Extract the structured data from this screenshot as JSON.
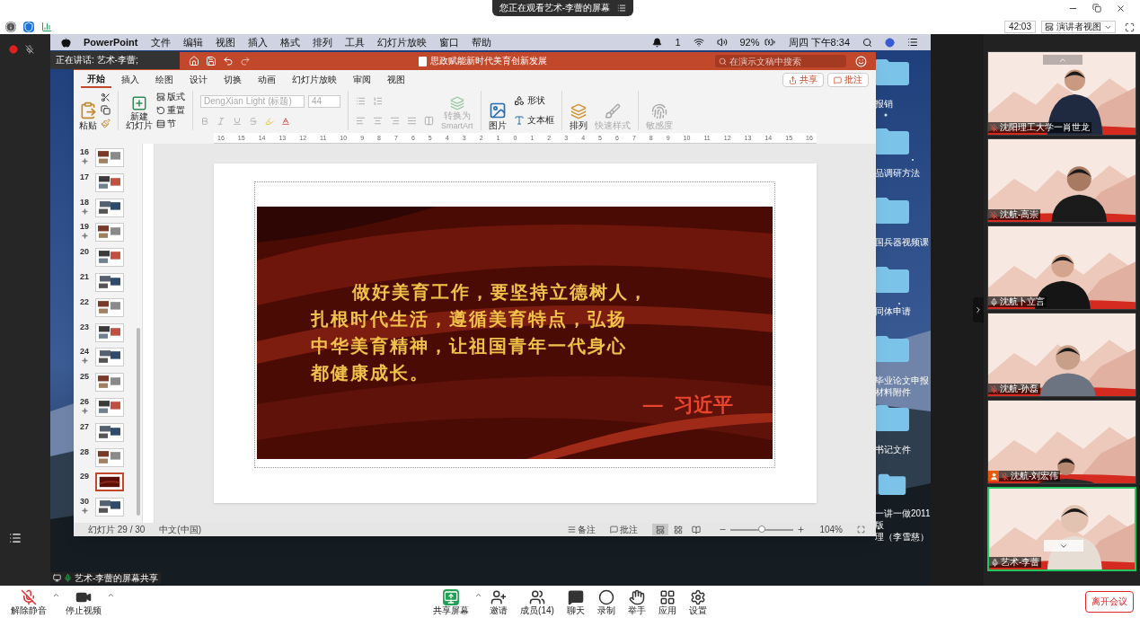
{
  "meeting_banner": {
    "text": "您正在观看艺术-李蕾的屏幕"
  },
  "meeting_bar": {
    "timer": "42:03",
    "view_menu": "演讲者视图"
  },
  "speaking_indicator": "正在讲话: 艺术-李蕾;",
  "mac_menubar": {
    "app": "PowerPoint",
    "menus": [
      "文件",
      "编辑",
      "视图",
      "插入",
      "格式",
      "排列",
      "工具",
      "幻灯片放映",
      "窗口",
      "帮助"
    ],
    "notification_count": "1",
    "battery": "92%",
    "clock": "周四 下午8:34"
  },
  "desktop_folders": [
    {
      "lines": [
        "报销"
      ]
    },
    {
      "lines": [
        "品调研方法"
      ]
    },
    {
      "lines": [
        "国兵器视频课"
      ]
    },
    {
      "lines": [
        "同体申请"
      ]
    },
    {
      "lines": [
        "毕业论文申报",
        "材料附件"
      ]
    },
    {
      "lines": [
        "书记文件"
      ]
    },
    {
      "lines": [
        "一讲一做2011版",
        "理（李雪慈）"
      ]
    }
  ],
  "ppt": {
    "title": "思政赋能新时代美育创新发展",
    "search": {
      "placeholder": "在演示文稿中搜索"
    },
    "tabs": [
      {
        "label": "开始",
        "selected": true
      },
      {
        "label": "插入",
        "selected": false
      },
      {
        "label": "绘图",
        "selected": false
      },
      {
        "label": "设计",
        "selected": false
      },
      {
        "label": "切换",
        "selected": false
      },
      {
        "label": "动画",
        "selected": false
      },
      {
        "label": "幻灯片放映",
        "selected": false
      },
      {
        "label": "审阅",
        "selected": false
      },
      {
        "label": "视图",
        "selected": false
      }
    ],
    "share_button": "共享",
    "comment_button": "批注",
    "ribbon": {
      "paste": "粘贴",
      "new_slide": [
        "新建",
        "幻灯片"
      ],
      "layout": "版式",
      "reset": "重置",
      "section": "节",
      "font": "DengXian Light (标题)",
      "font_size": "44",
      "smartart": [
        "转换为",
        "SmartArt"
      ],
      "picture": "图片",
      "shapes": "形状",
      "textbox": "文本框",
      "arrange": "排列",
      "quick_styles": "快速样式",
      "sensitivity": "敏感度"
    },
    "ruler_labels": [
      "16",
      "15",
      "14",
      "13",
      "12",
      "11",
      "10",
      "9",
      "8",
      "7",
      "6",
      "5",
      "4",
      "3",
      "2",
      "1",
      "0",
      "1",
      "2",
      "3",
      "4",
      "5",
      "6",
      "7",
      "8",
      "9",
      "10",
      "11",
      "12",
      "13",
      "14",
      "15",
      "16"
    ],
    "slides": [
      {
        "number": "16",
        "selected": false,
        "has_animation": true
      },
      {
        "number": "17",
        "selected": false,
        "has_animation": false
      },
      {
        "number": "18",
        "selected": false,
        "has_animation": true
      },
      {
        "number": "19",
        "selected": false,
        "has_animation": true
      },
      {
        "number": "20",
        "selected": false,
        "has_animation": false
      },
      {
        "number": "21",
        "selected": false,
        "has_animation": false
      },
      {
        "number": "22",
        "selected": false,
        "has_animation": false
      },
      {
        "number": "23",
        "selected": false,
        "has_animation": false
      },
      {
        "number": "24",
        "selected": false,
        "has_animation": true
      },
      {
        "number": "25",
        "selected": false,
        "has_animation": false
      },
      {
        "number": "26",
        "selected": false,
        "has_animation": true
      },
      {
        "number": "27",
        "selected": false,
        "has_animation": false
      },
      {
        "number": "28",
        "selected": false,
        "has_animation": false
      },
      {
        "number": "29",
        "selected": true,
        "has_animation": false
      },
      {
        "number": "30",
        "selected": false,
        "has_animation": true
      }
    ],
    "slide": {
      "quote_lines": [
        "做好美育工作，要坚持立德树人，",
        "扎根时代生活，遵循美育特点，弘扬",
        "中华美育精神，让祖国青年一代身心",
        "都健康成长。"
      ],
      "attribution": "—  习近平"
    },
    "status_bar": {
      "slide_counter": "幻灯片 29 / 30",
      "language": "中文(中国)",
      "notes": "备注",
      "comments": "批注",
      "views": [
        {
          "kind": "normal",
          "selected": true
        },
        {
          "kind": "sorter",
          "selected": false
        },
        {
          "kind": "reading",
          "selected": false
        }
      ],
      "zoom_slider": {
        "level": 0.5
      },
      "zoom": "104%"
    }
  },
  "video_tiles": [
    {
      "name": "沈阳理工大学一肖世龙",
      "muted": true,
      "person_badge": false,
      "selected": false
    },
    {
      "name": "沈航-高崇",
      "muted": true,
      "person_badge": false,
      "selected": false
    },
    {
      "name": "沈航卜立言",
      "muted": false,
      "person_badge": false,
      "selected": false
    },
    {
      "name": "沈航-孙磊",
      "muted": true,
      "person_badge": false,
      "selected": false
    },
    {
      "name": "沈航-刘宏伟",
      "muted": true,
      "person_badge": true,
      "selected": false
    },
    {
      "name": "艺术-李蕾",
      "muted": false,
      "person_badge": false,
      "selected": true
    }
  ],
  "share_label": "艺术-李蕾的屏幕共享",
  "toolbar": {
    "left": [
      {
        "kind": "mic-off",
        "label": "解除静音"
      },
      {
        "kind": "video",
        "label": "停止视频"
      }
    ],
    "center": [
      {
        "kind": "share",
        "label": "共享屏幕"
      },
      {
        "kind": "invite",
        "label": "邀请"
      },
      {
        "kind": "participants",
        "label": "成员(14)"
      },
      {
        "kind": "chat",
        "label": "聊天"
      },
      {
        "kind": "record",
        "label": "录制"
      },
      {
        "kind": "raise-hand",
        "label": "举手"
      },
      {
        "kind": "apps",
        "label": "应用"
      },
      {
        "kind": "settings",
        "label": "设置"
      }
    ],
    "leave": "离开会议"
  }
}
